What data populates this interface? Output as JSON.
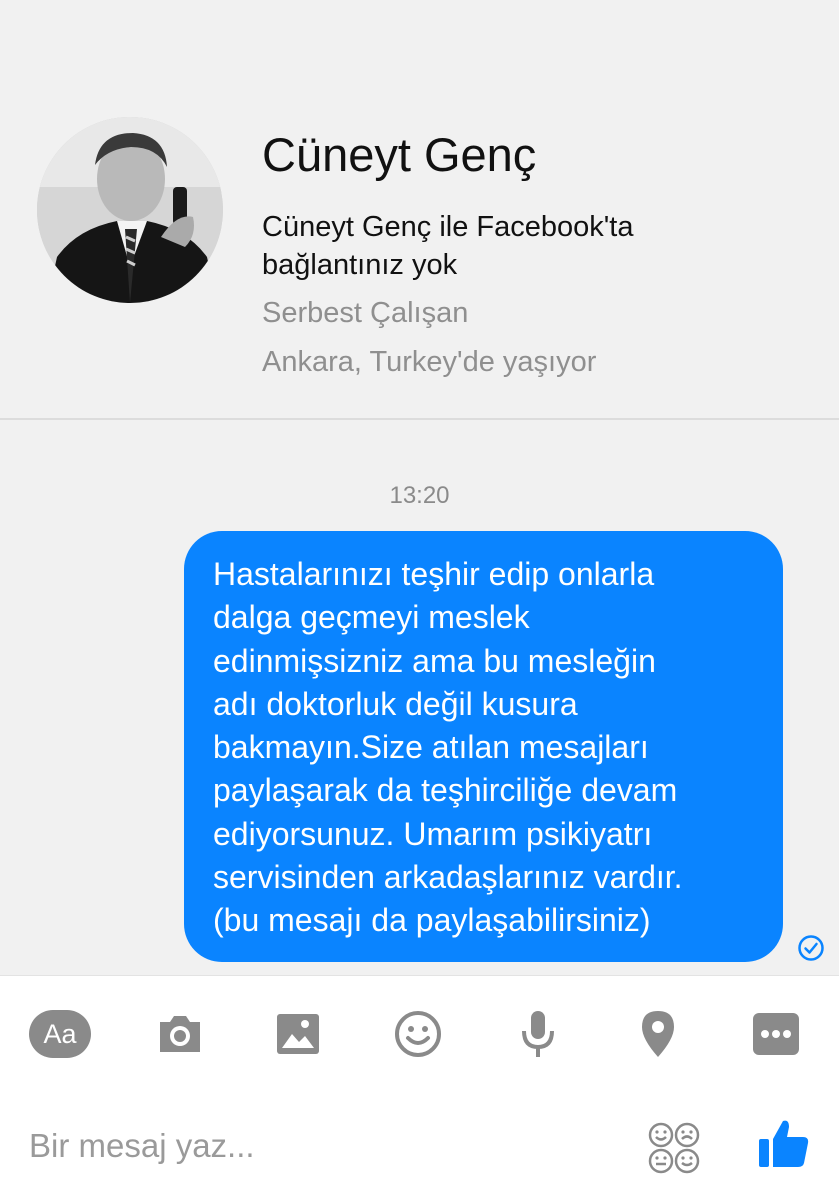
{
  "profile": {
    "name": "Cüneyt Genç",
    "connection_status": "Cüneyt Genç ile Facebook'ta bağlantınız yok",
    "work": "Serbest Çalışan",
    "location": "Ankara, Turkey'de yaşıyor"
  },
  "thread": {
    "timestamp": "13:20",
    "messages": [
      {
        "direction": "outgoing",
        "text": "Hastalarınızı teşhir edip onlarla\ndalga geçmeyi meslek\nedinmişsizniz ama bu mesleğin\nadı doktorluk değil kusura\nbakmayın.Size atılan mesajları\npaylaşarak da teşhirciliğe devam\nediyorsunuz. Umarım psikiyatrı\nservisinden arkadaşlarınız vardır.\n(bu mesajı da paylaşabilirsiniz)",
        "status_icon": "seen-check-icon"
      }
    ]
  },
  "composer": {
    "toolbar": {
      "text_button_label": "Aa",
      "icons": [
        "text-format-icon",
        "camera-icon",
        "gallery-icon",
        "emoji-icon",
        "microphone-icon",
        "location-pin-icon",
        "more-icon"
      ]
    },
    "placeholder": "Bir mesaj yaz...",
    "sticker_icon": "sticker-icon",
    "send_icon": "like-thumb-icon"
  },
  "colors": {
    "bubble": "#0a84ff",
    "accent": "#0a84ff",
    "icon_gray": "#8a8a8a",
    "background": "#f1f1f1"
  }
}
